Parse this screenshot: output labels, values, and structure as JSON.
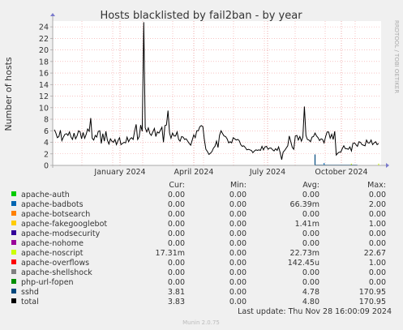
{
  "chart_data": {
    "type": "line",
    "title": "Hosts blacklisted by fail2ban - by year",
    "ylabel": "Number of hosts",
    "side_label": "RRDTOOL / TOBI OETIKER",
    "x_ticks": [
      "January 2024",
      "April 2024",
      "July 2024",
      "October 2024"
    ],
    "y_ticks": [
      0,
      2,
      4,
      6,
      8,
      10,
      12,
      14,
      16,
      18,
      20,
      22,
      24
    ],
    "ylim": [
      0,
      25
    ],
    "grid": true,
    "legend_headers": [
      "Cur:",
      "Min:",
      "Avg:",
      "Max:"
    ],
    "series": [
      {
        "name": "apache-auth",
        "color": "#00cc00",
        "cur": "0.00",
        "min": "0.00",
        "avg": "0.00",
        "max": "0.00"
      },
      {
        "name": "apache-badbots",
        "color": "#0066b3",
        "cur": "0.00",
        "min": "0.00",
        "avg": "66.39m",
        "max": "2.00"
      },
      {
        "name": "apache-botsearch",
        "color": "#ff8000",
        "cur": "0.00",
        "min": "0.00",
        "avg": "0.00",
        "max": "0.00"
      },
      {
        "name": "apache-fakegooglebot",
        "color": "#ffcc00",
        "cur": "0.00",
        "min": "0.00",
        "avg": "1.41m",
        "max": "1.00"
      },
      {
        "name": "apache-modsecurity",
        "color": "#330099",
        "cur": "0.00",
        "min": "0.00",
        "avg": "0.00",
        "max": "0.00"
      },
      {
        "name": "apache-nohome",
        "color": "#990099",
        "cur": "0.00",
        "min": "0.00",
        "avg": "0.00",
        "max": "0.00"
      },
      {
        "name": "apache-noscript",
        "color": "#ccff00",
        "cur": "17.31m",
        "min": "0.00",
        "avg": "22.73m",
        "max": "22.67"
      },
      {
        "name": "apache-overflows",
        "color": "#ff0000",
        "cur": "0.00",
        "min": "0.00",
        "avg": "142.45u",
        "max": "1.00"
      },
      {
        "name": "apache-shellshock",
        "color": "#808080",
        "cur": "0.00",
        "min": "0.00",
        "avg": "0.00",
        "max": "0.00"
      },
      {
        "name": "php-url-fopen",
        "color": "#008f00",
        "cur": "0.00",
        "min": "0.00",
        "avg": "0.00",
        "max": "0.00"
      },
      {
        "name": "sshd",
        "color": "#00487d",
        "cur": "3.81",
        "min": "0.00",
        "avg": "4.78",
        "max": "170.95"
      },
      {
        "name": "total",
        "color": "#000000",
        "cur": "3.83",
        "min": "0.00",
        "avg": "4.80",
        "max": "170.95"
      }
    ],
    "total_points": [
      6.2,
      5.6,
      4.8,
      5.0,
      6.1,
      4.3,
      4.9,
      5.4,
      5.5,
      5.2,
      5.8,
      4.9,
      4.5,
      5.6,
      4.6,
      5.1,
      6.0,
      5.8,
      4.6,
      5.7,
      4.7,
      5.4,
      6.3,
      5.9,
      8.2,
      4.7,
      4.4,
      5.2,
      4.9,
      5.9,
      6.0,
      3.8,
      5.5,
      4.2,
      5.9,
      4.4,
      3.7,
      4.6,
      4.2,
      4.0,
      4.5,
      3.6,
      4.3,
      4.8,
      3.6,
      3.8,
      4.0,
      3.9,
      4.9,
      4.1,
      4.6,
      4.8,
      4.5,
      6.0,
      7.1,
      4.5,
      5.0,
      7.0,
      5.9,
      24.8,
      6.5,
      5.8,
      6.5,
      5.5,
      5.2,
      5.8,
      6.4,
      5.0,
      5.8,
      5.6,
      6.1,
      6.6,
      4.0,
      6.9,
      7.0,
      9.5,
      5.6,
      4.7,
      5.6,
      5.1,
      5.1,
      5.8,
      4.5,
      4.2,
      5.0,
      4.9,
      4.5,
      4.6,
      4.2,
      3.8,
      3.5,
      4.4,
      5.3,
      4.8,
      6.0,
      6.0,
      6.7,
      6.9,
      6.7,
      4.5,
      2.8,
      2.4,
      1.9,
      2.1,
      2.4,
      3.0,
      3.3,
      4.2,
      3.1,
      5.2,
      6.0,
      5.5,
      5.1,
      5.0,
      4.6,
      3.9,
      4.1,
      3.9,
      4.8,
      4.6,
      4.4,
      4.5,
      4.3,
      3.6,
      3.3,
      3.4,
      3.1,
      2.7,
      2.8,
      2.7,
      2.6,
      2.2,
      2.5,
      2.7,
      2.6,
      2.7,
      2.6,
      3.3,
      2.7,
      3.2,
      3.3,
      2.8,
      3.0,
      3.0,
      2.7,
      2.5,
      2.9,
      2.6,
      3.2,
      2.2,
      1.0,
      2.3,
      2.6,
      3.0,
      3.4,
      5.1,
      4.1,
      3.1,
      2.8,
      5.1,
      5.2,
      4.4,
      5.0,
      4.2,
      4.9,
      10.2,
      5.2,
      4.5,
      4.4,
      4.1,
      4.9,
      5.0,
      5.6,
      5.1,
      4.8,
      4.3,
      4.6,
      4.5,
      3.9,
      5.0,
      5.8,
      5.8,
      4.7,
      5.4,
      4.5,
      5.9,
      1.8,
      2.1,
      2.3,
      2.3,
      2.9,
      3.4,
      2.9,
      2.9,
      2.8,
      3.2,
      2.5,
      3.8,
      3.9,
      3.6,
      3.3,
      4.1,
      4.0,
      3.6,
      3.5,
      3.4,
      4.4,
      3.9,
      3.9,
      4.4,
      3.6,
      3.9,
      4.1,
      3.6,
      3.8
    ],
    "sshd_spikes": [
      {
        "i": 172,
        "v": 1.9
      }
    ],
    "badbots_spikes": [
      {
        "i": 178,
        "v": 0.4
      }
    ],
    "noscript_spikes": [
      {
        "i": 196,
        "v": 0.3
      },
      {
        "i": 214,
        "v": 0.3
      }
    ]
  },
  "footer": {
    "last_update": "Last update: Thu Nov 28 16:00:09 2024",
    "munin": "Munin 2.0.75"
  }
}
